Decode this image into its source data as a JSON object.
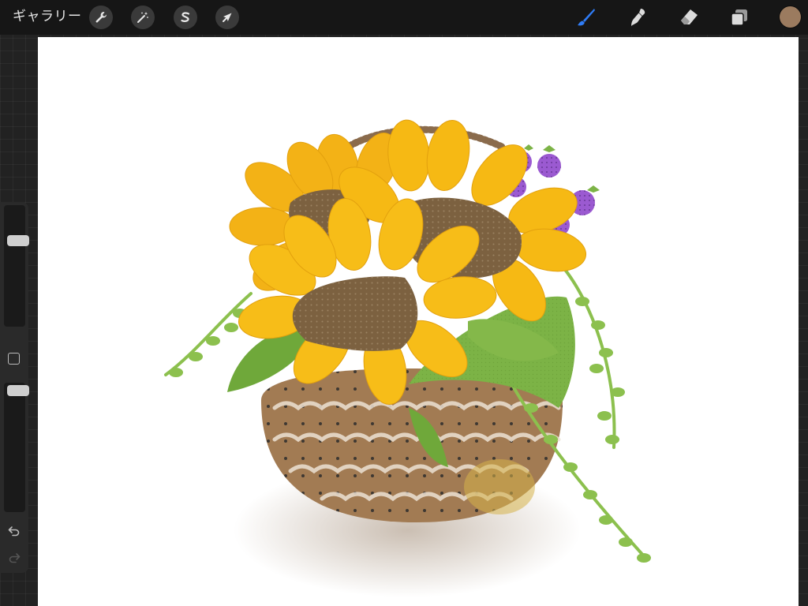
{
  "toolbar": {
    "gallery_label": "ギャラリー",
    "actions_icon": "wrench-icon",
    "adjustments_icon": "magic-wand-icon",
    "selection_icon": "selection-s-icon",
    "transform_icon": "arrow-cursor-icon",
    "brush_icon": "brush-icon",
    "smudge_icon": "smudge-icon",
    "eraser_icon": "eraser-icon",
    "layers_icon": "layers-icon",
    "active_color": "#9b7b5f",
    "active_tool_color": "#2f7cf6"
  },
  "sidebar": {
    "brush_size_level": 0.73,
    "opacity_level": 0.98,
    "modify_icon": "square-icon",
    "undo_icon": "undo-icon",
    "redo_icon": "redo-icon"
  },
  "canvas": {
    "background": "#ffffff",
    "artwork_colors": {
      "basket": "#9a7550",
      "sunflower_petal": "#f6b914",
      "sunflower_center": "#7c6140",
      "leaf": "#84b84a",
      "vine": "#8cc04e",
      "berry": "#9b5ad1"
    }
  }
}
